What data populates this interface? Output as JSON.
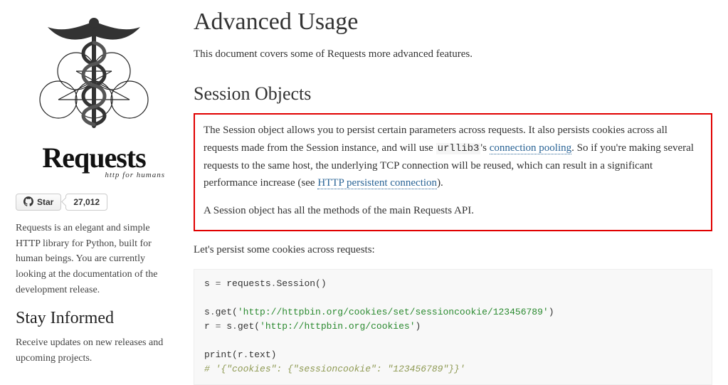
{
  "sidebar": {
    "brand": "Requests",
    "brand_sub": "http for humans",
    "github": {
      "star_label": "Star",
      "star_count": "27,012"
    },
    "intro": "Requests is an elegant and simple HTTP library for Python, built for human beings. You are currently looking at the documentation of the development release.",
    "stay_heading": "Stay Informed",
    "stay_text": "Receive updates on new releases and upcoming projects."
  },
  "content": {
    "h1": "Advanced Usage",
    "lead": "This document covers some of Requests more advanced features.",
    "h2": "Session Objects",
    "para1_a": "The Session object allows you to persist certain parameters across requests. It also persists cookies across all requests made from the Session instance, and will use ",
    "para1_code": "urllib3",
    "para1_b": "'s ",
    "para1_link1": "connection pooling",
    "para1_c": ". So if you're making several requests to the same host, the underlying TCP connection will be reused, which can result in a significant performance increase (see ",
    "para1_link2": "HTTP persistent connection",
    "para1_d": ").",
    "para2": "A Session object has all the methods of the main Requests API.",
    "para3": "Let's persist some cookies across requests:",
    "code": {
      "l1a": "s ",
      "l1b": "=",
      "l1c": " requests",
      "l1d": ".",
      "l1e": "Session()",
      "l2a": "s",
      "l2b": ".",
      "l2c": "get(",
      "l2s": "'http://httpbin.org/cookies/set/sessioncookie/123456789'",
      "l2d": ")",
      "l3a": "r ",
      "l3b": "=",
      "l3c": " s",
      "l3d": ".",
      "l3e": "get(",
      "l3s": "'http://httpbin.org/cookies'",
      "l3f": ")",
      "l4a": "print",
      "l4b": "(r",
      "l4c": ".",
      "l4d": "text)",
      "l5": "# '{\"cookies\": {\"sessioncookie\": \"123456789\"}}'"
    }
  }
}
